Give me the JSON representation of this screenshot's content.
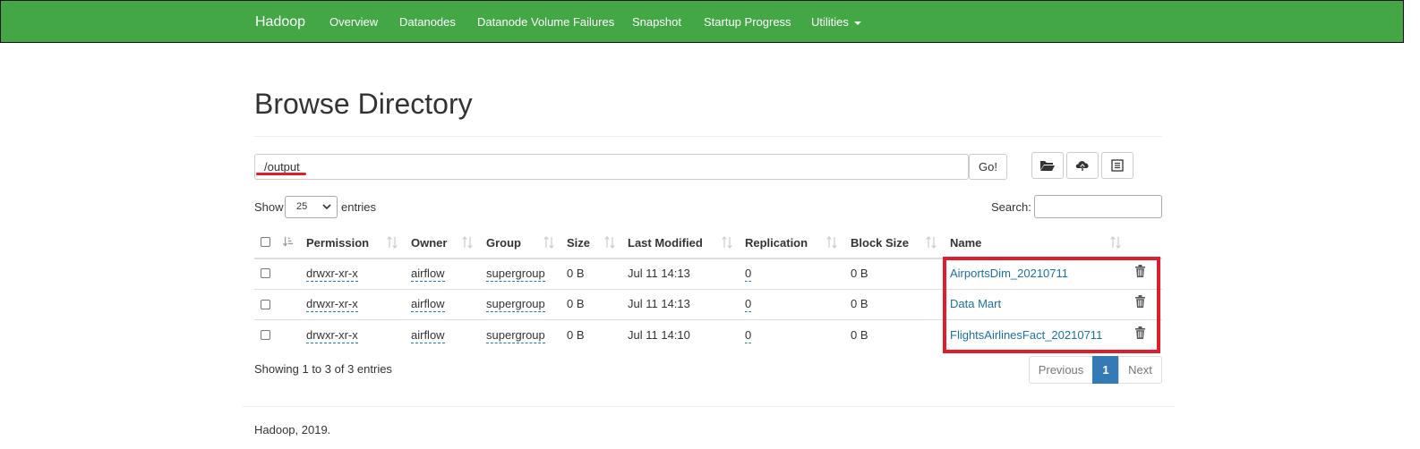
{
  "navbar": {
    "brand": "Hadoop",
    "items": [
      "Overview",
      "Datanodes",
      "Datanode Volume Failures",
      "Snapshot",
      "Startup Progress",
      "Utilities"
    ]
  },
  "page": {
    "title": "Browse Directory"
  },
  "path_bar": {
    "value": "/output",
    "go_label": "Go!"
  },
  "toolbar_icons": [
    "folder-open-icon",
    "cloud-upload-icon",
    "list-icon"
  ],
  "length_control": {
    "show_label": "Show",
    "selected": "25",
    "entries_label": "entries"
  },
  "search": {
    "label": "Search:",
    "value": ""
  },
  "table": {
    "headers": [
      "Permission",
      "Owner",
      "Group",
      "Size",
      "Last Modified",
      "Replication",
      "Block Size",
      "Name"
    ],
    "rows": [
      [
        "drwxr-xr-x",
        "airflow",
        "supergroup",
        "0 B",
        "Jul 11 14:13",
        "0",
        "0 B",
        "AirportsDim_20210711"
      ],
      [
        "drwxr-xr-x",
        "airflow",
        "supergroup",
        "0 B",
        "Jul 11 14:13",
        "0",
        "0 B",
        "Data Mart"
      ],
      [
        "drwxr-xr-x",
        "airflow",
        "supergroup",
        "0 B",
        "Jul 11 14:10",
        "0",
        "0 B",
        "FlightsAirlinesFact_20210711"
      ]
    ]
  },
  "info": "Showing 1 to 3 of 3 entries",
  "pagination": {
    "previous": "Previous",
    "current": "1",
    "next": "Next"
  },
  "footer": "Hadoop, 2019.",
  "colors": {
    "navbar": "#43a746",
    "link": "#1d6fa5",
    "active_page": "#337ab7",
    "highlight": "#e01e2b"
  }
}
